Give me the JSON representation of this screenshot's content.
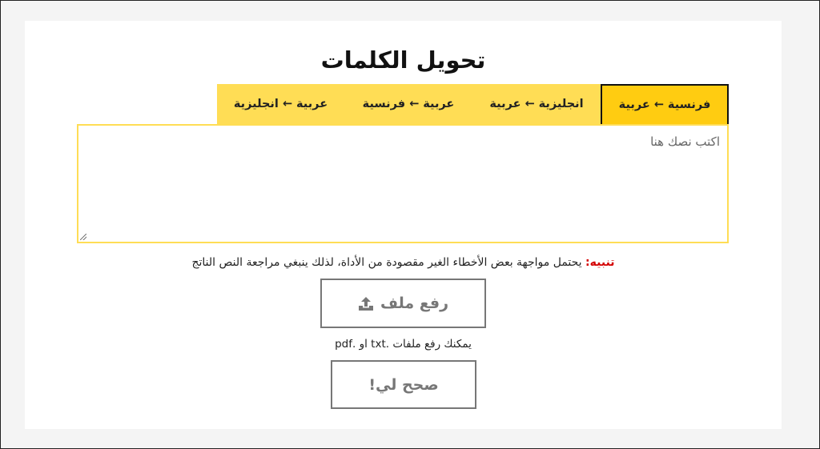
{
  "page": {
    "title": "تحويل الكلمات"
  },
  "tabs": [
    {
      "from": "فرنسية",
      "to": "عربية",
      "active": true
    },
    {
      "from": "انجليزية",
      "to": "عربية",
      "active": false
    },
    {
      "from": "عربية",
      "to": "فرنسية",
      "active": false
    },
    {
      "from": "عربية",
      "to": "انجليزية",
      "active": false
    }
  ],
  "tab_arrow": "←",
  "input": {
    "value": "",
    "placeholder": "اكتب  نصك  هنا"
  },
  "warning": {
    "label": "تنبيه:",
    "text": " يحتمل مواجهة بعض الأخطاء الغير مقصودة من الأداة، لذلك ينبغي مراجعة النص الناتج"
  },
  "upload": {
    "label": "رفع ملف",
    "icon": "upload-icon"
  },
  "file_hint": "يمكنك رفع ملفات .txt او .pdf",
  "correct": {
    "label": "صحح لي!"
  },
  "colors": {
    "tab_bar": "#ffdd55",
    "active_tab": "#ffcc11",
    "warning": "#d40000",
    "button_border": "#777777"
  }
}
